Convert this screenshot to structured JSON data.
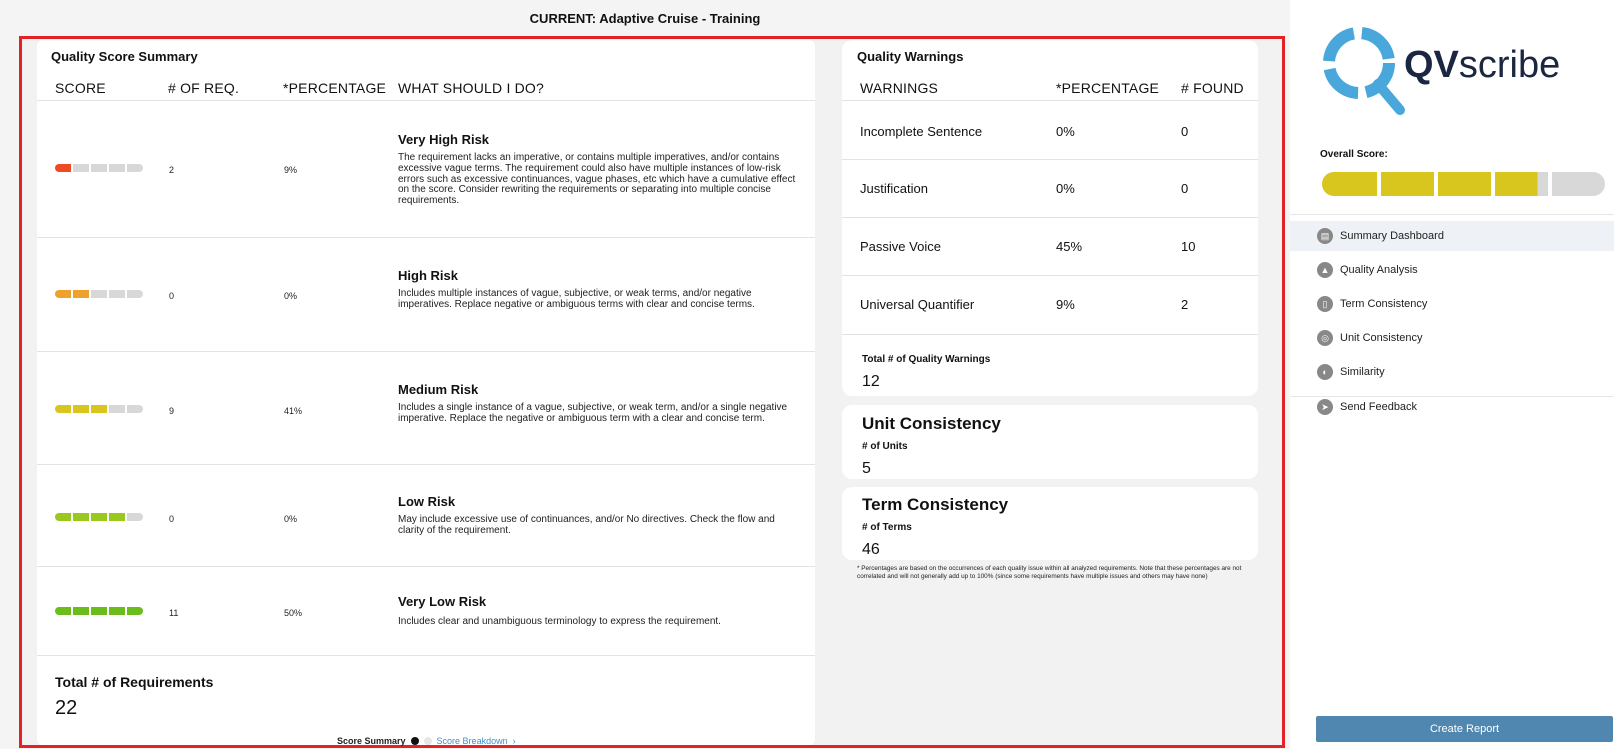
{
  "window": {
    "title": "CURRENT: Adaptive Cruise - Training"
  },
  "colors": {
    "very_high": "#ee4a23",
    "high": "#f0a12d",
    "medium": "#d8c51d",
    "low": "#9bc71e",
    "very_low": "#6bbd1b",
    "empty": "#d8d8d8",
    "frame": "#e32227",
    "accent": "#4f87b0"
  },
  "summary": {
    "title": "Quality Score Summary",
    "headers": [
      "SCORE",
      "# OF REQ.",
      "*PERCENTAGE",
      "WHAT SHOULD I DO?"
    ],
    "rows": [
      {
        "level": 1,
        "count": "2",
        "percentage": "9%",
        "risk": "Very High Risk",
        "desc": "The requirement lacks an imperative, or contains multiple imperatives, and/or contains excessive vague terms. The requirement could also have multiple instances of low-risk errors such as excessive continuances, vague phases, etc which have a cumulative effect on the score. Consider rewriting the requirements or separating into multiple concise requirements."
      },
      {
        "level": 2,
        "count": "0",
        "percentage": "0%",
        "risk": "High Risk",
        "desc": "Includes multiple instances of vague, subjective, or weak terms, and/or negative imperatives. Replace negative or ambiguous terms with clear and concise terms."
      },
      {
        "level": 3,
        "count": "9",
        "percentage": "41%",
        "risk": "Medium Risk",
        "desc": "Includes a single instance of a vague, subjective, or weak term, and/or a single negative imperative. Replace the negative or ambiguous term with a clear and concise term."
      },
      {
        "level": 4,
        "count": "0",
        "percentage": "0%",
        "risk": "Low Risk",
        "desc": "May include excessive use of continuances, and/or No directives. Check the flow and clarity of the requirement."
      },
      {
        "level": 5,
        "count": "11",
        "percentage": "50%",
        "risk": "Very Low Risk",
        "desc": "Includes clear and unambiguous terminology to express the requirement."
      }
    ],
    "total_label": "Total # of Requirements",
    "total_value": "22",
    "pager": {
      "current": "Score Summary",
      "next": "Score Breakdown"
    }
  },
  "warnings": {
    "title": "Quality Warnings",
    "headers": [
      "WARNINGS",
      "*PERCENTAGE",
      "# FOUND"
    ],
    "rows": [
      {
        "name": "Incomplete Sentence",
        "percentage": "0%",
        "found": "0"
      },
      {
        "name": "Justification",
        "percentage": "0%",
        "found": "0"
      },
      {
        "name": "Passive Voice",
        "percentage": "45%",
        "found": "10"
      },
      {
        "name": "Universal Quantifier",
        "percentage": "9%",
        "found": "2"
      }
    ],
    "total_label": "Total # of Quality Warnings",
    "total_value": "12"
  },
  "unit_consistency": {
    "title": "Unit Consistency",
    "label": "# of Units",
    "value": "5"
  },
  "term_consistency": {
    "title": "Term Consistency",
    "label": "# of Terms",
    "value": "46"
  },
  "footnote": "* Percentages are based on the occurrences of each quality issue within all analyzed requirements. Note that these percentages are not correlated and will not generally add up to 100% (since some requirements have multiple issues and others may have none)",
  "sidebar": {
    "logo_bold": "QV",
    "logo_rest": "scribe",
    "overall_label": "Overall Score:",
    "overall_level": 3.8,
    "nav": [
      {
        "label": "Summary Dashboard",
        "icon": "dashboard-icon",
        "glyph": "▤",
        "active": true
      },
      {
        "label": "Quality Analysis",
        "icon": "warning-icon",
        "glyph": "▲",
        "active": false
      },
      {
        "label": "Term Consistency",
        "icon": "document-icon",
        "glyph": "▯",
        "active": false
      },
      {
        "label": "Unit Consistency",
        "icon": "globe-icon",
        "glyph": "◎",
        "active": false
      },
      {
        "label": "Similarity",
        "icon": "similarity-icon",
        "glyph": "◐",
        "active": false
      },
      {
        "label": "Send Feedback",
        "icon": "send-icon",
        "glyph": "➤",
        "active": false
      }
    ],
    "create_report": "Create Report"
  }
}
